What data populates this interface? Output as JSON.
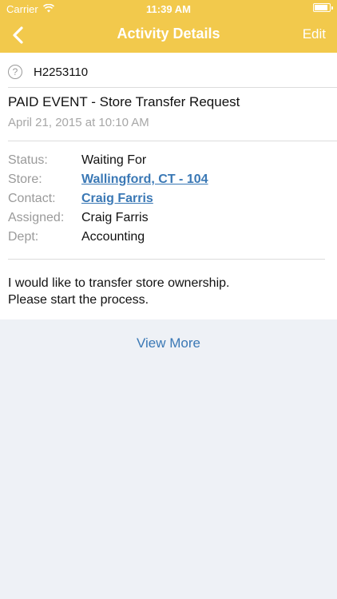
{
  "status_bar": {
    "carrier": "Carrier",
    "time": "11:39 AM"
  },
  "nav": {
    "title": "Activity Details",
    "edit_label": "Edit"
  },
  "activity": {
    "id": "H2253110",
    "title": "PAID EVENT - Store Transfer Request",
    "date": "April 21, 2015 at 10:10 AM",
    "details": [
      {
        "label": "Status:",
        "value": "Waiting For"
      },
      {
        "label": "Store:",
        "value": "Wallingford, CT - 104"
      },
      {
        "label": "Contact:",
        "value": "Craig Farris"
      },
      {
        "label": "Assigned:",
        "value": "Craig Farris"
      },
      {
        "label": "Dept:",
        "value": "Accounting"
      }
    ],
    "message_line1": "I would like to transfer store ownership.",
    "message_line2": "Please start the process."
  },
  "view_more_label": "View More",
  "colors": {
    "nav_bg": "#f2c94c",
    "link": "#3a78b5",
    "page_bg": "#eef1f6"
  },
  "icons": {
    "back": "chevron-left-icon",
    "help": "question-circle-icon",
    "wifi": "wifi-icon",
    "battery": "battery-icon"
  }
}
